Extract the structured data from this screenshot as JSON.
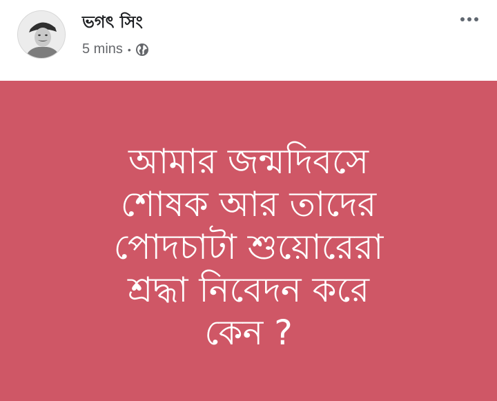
{
  "author": {
    "name": "ভগৎ সিং",
    "avatar_icon": "profile-photo"
  },
  "meta": {
    "time": "5 mins",
    "separator": "•",
    "privacy_icon": "globe-icon"
  },
  "menu": {
    "icon": "more-options-icon"
  },
  "post": {
    "background_color": "#cf5766",
    "text_color": "#ffffff",
    "lines": [
      "আমার জন্মদিবসে",
      "শোষক আর তাদের",
      "পোদচাটা শুয়োরেরা",
      "শ্রদ্ধা নিবেদন করে",
      "কেন ?"
    ]
  }
}
